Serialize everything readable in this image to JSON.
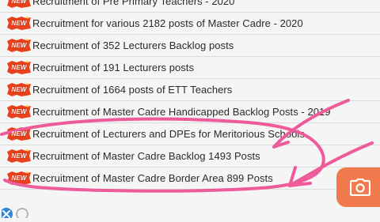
{
  "badge": {
    "text": "NEW",
    "color": "#e8401c",
    "accent": "#ffd21a"
  },
  "rows": [
    {
      "label": "Recruitment of Pre Primary Teachers - 2020"
    },
    {
      "label": "Recruitment for various 2182 posts of Master Cadre - 2020"
    },
    {
      "label": "Recruitment of 352 Lecturers Backlog posts"
    },
    {
      "label": "Recruitment of 191 Lecturers posts"
    },
    {
      "label": "Recruitment of 1664 posts of ETT Teachers"
    },
    {
      "label": "Recruitment of Master Cadre Handicapped Backlog Posts - 2019"
    },
    {
      "label": "Recruitment of Lecturers and DPEs for Meritorious Schools"
    },
    {
      "label": "Recruitment of Master Cadre Backlog 1493 Posts"
    },
    {
      "label": "Recruitment of Master Cadre Border Area 899 Posts"
    }
  ],
  "fab": {
    "icon": "camera-icon",
    "color": "#f07a4c"
  },
  "annotation": {
    "color": "#ee5a9a"
  }
}
